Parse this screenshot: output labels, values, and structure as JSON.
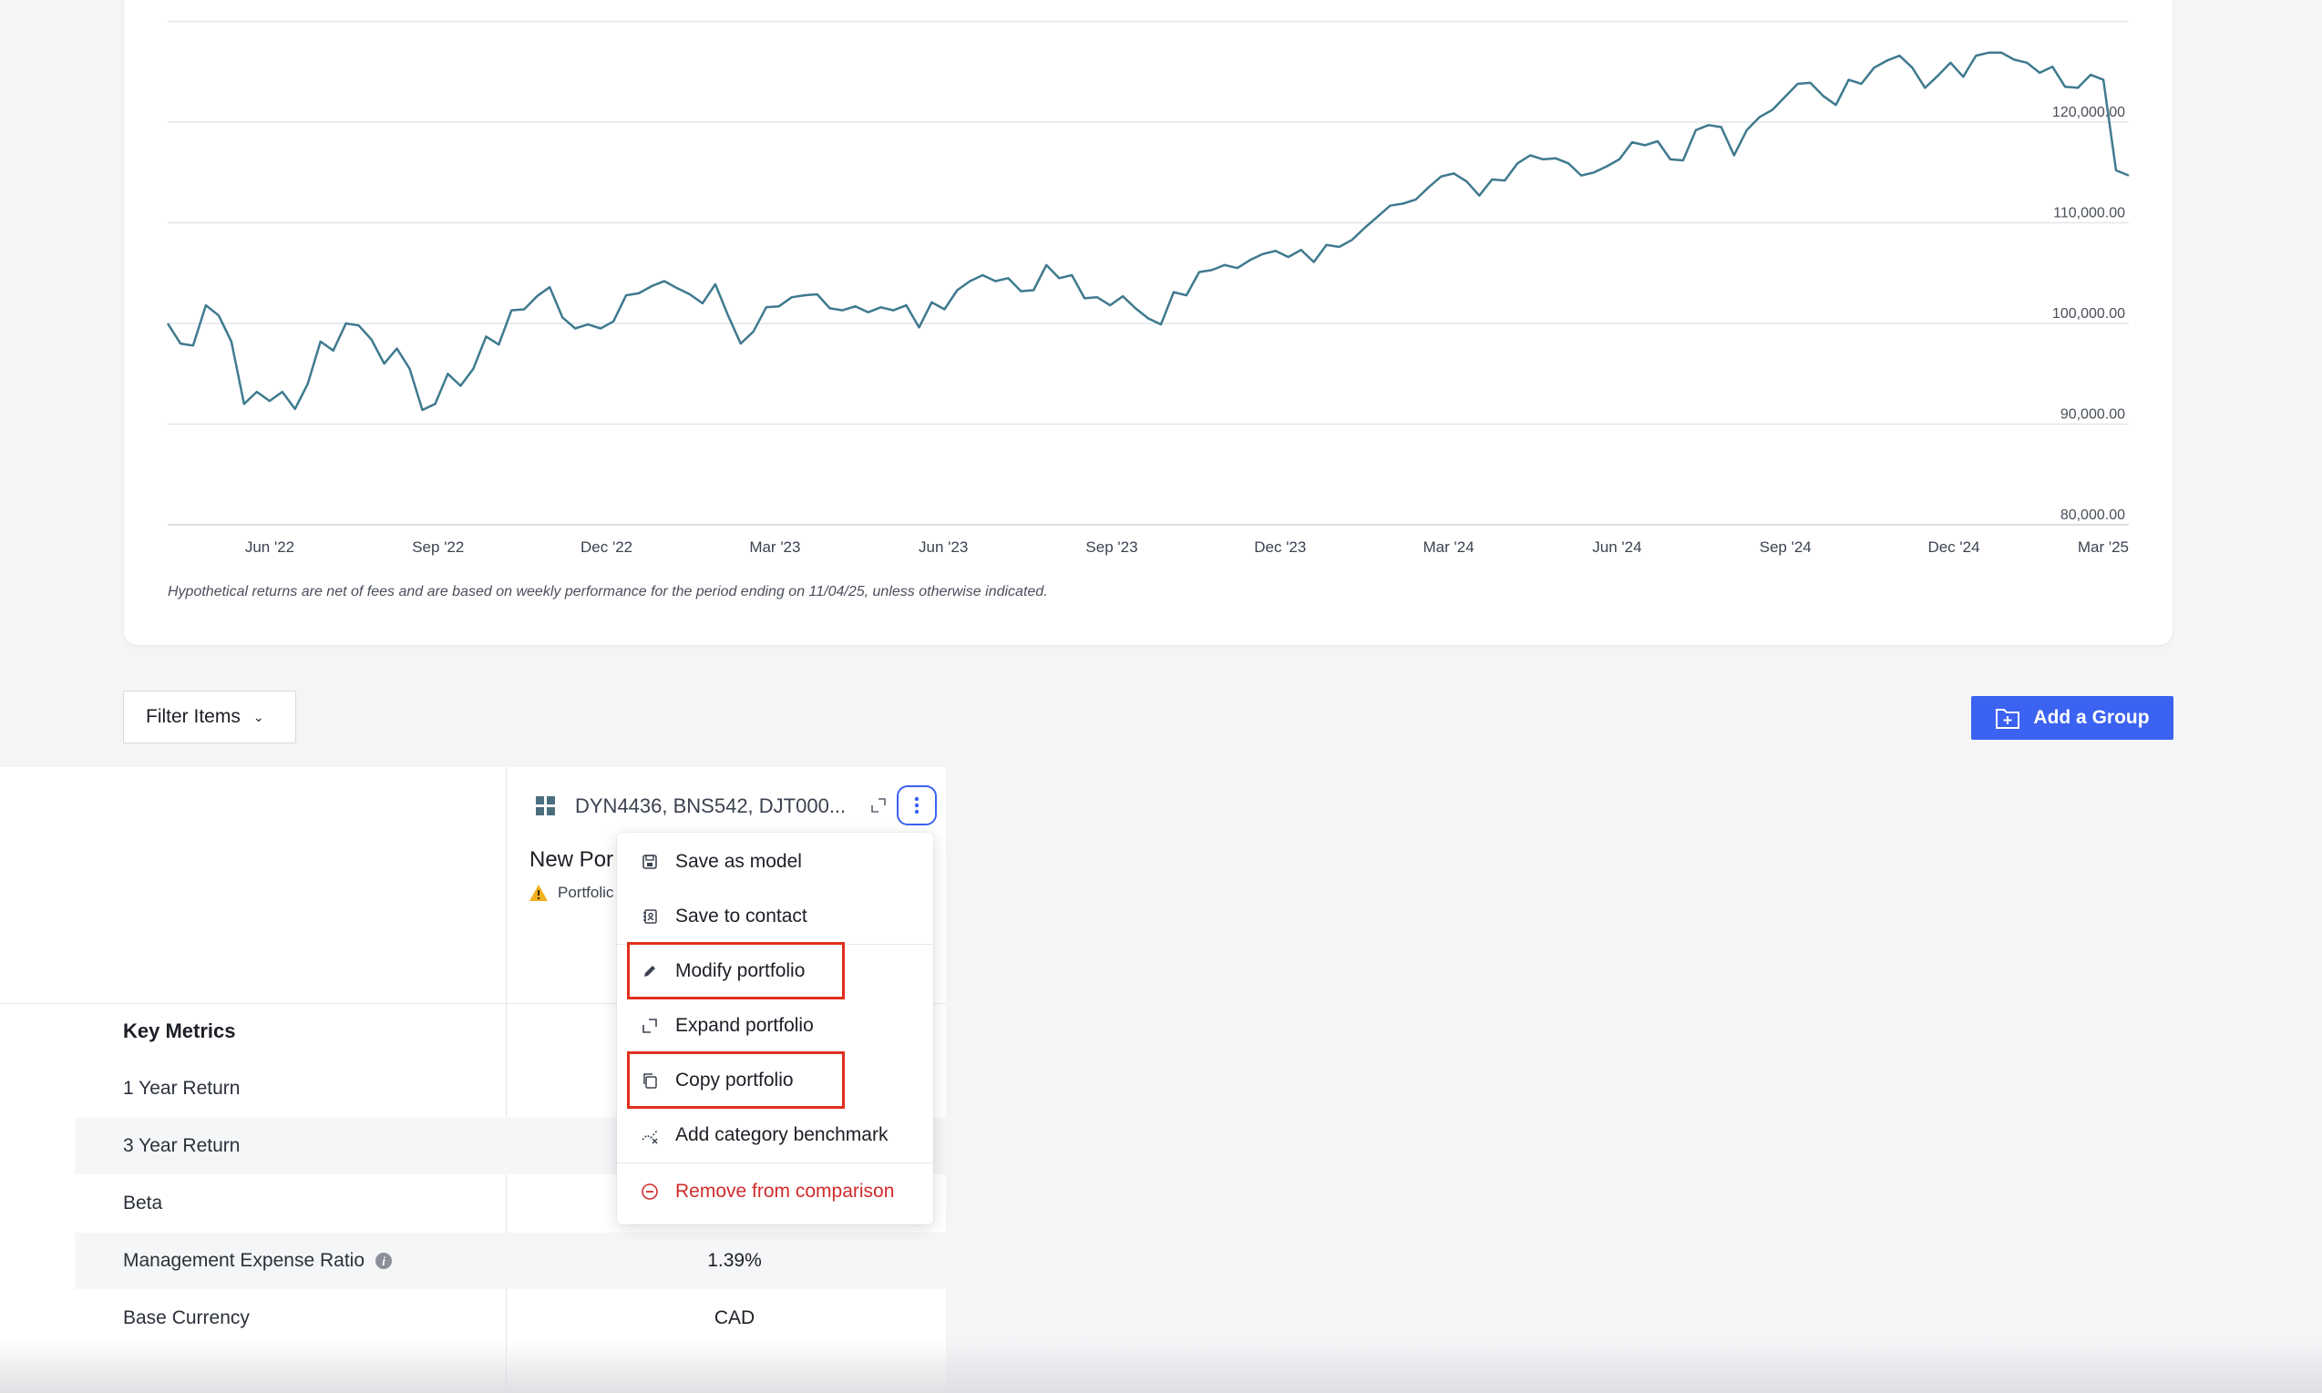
{
  "chart_data": {
    "type": "line",
    "x_ticks": [
      "Jun '22",
      "Sep '22",
      "Dec '22",
      "Mar '23",
      "Jun '23",
      "Sep '23",
      "Dec '23",
      "Mar '24",
      "Jun '24",
      "Sep '24",
      "Dec '24",
      "Mar '25"
    ],
    "y_ticks": [
      "80,000.00",
      "90,000.00",
      "100,000.00",
      "110,000.00",
      "120,000.00"
    ],
    "ylim": [
      80000,
      130000
    ],
    "grid": true,
    "color": "#3f7a8f",
    "series": [
      {
        "values": [
          100000,
          98000,
          97800,
          101800,
          100800,
          98200,
          92000,
          93200,
          92300,
          93200,
          91500,
          94000,
          98200,
          97300,
          100000,
          99800,
          98400,
          96000,
          97500,
          95500,
          91400,
          92000,
          95000,
          93800,
          95500,
          98700,
          97900,
          101300,
          101400,
          102700,
          103600,
          100600,
          99500,
          99900,
          99500,
          100200,
          102800,
          103000,
          103700,
          104200,
          103500,
          102900,
          102000,
          103900,
          100800,
          98000,
          99200,
          101600,
          101700,
          102600,
          102800,
          102900,
          101500,
          101300,
          101700,
          101100,
          101600,
          101300,
          101800,
          99600,
          102100,
          101400,
          103300,
          104200,
          104800,
          104200,
          104500,
          103200,
          103300,
          105800,
          104500,
          104800,
          102500,
          102600,
          101800,
          102700,
          101500,
          100500,
          99900,
          103100,
          102800,
          105100,
          105300,
          105800,
          105500,
          106300,
          106900,
          107200,
          106600,
          107300,
          106100,
          107800,
          107600,
          108300,
          109500,
          110600,
          111700,
          111900,
          112300,
          113500,
          114600,
          114900,
          114100,
          112700,
          114300,
          114200,
          115900,
          116700,
          116300,
          116400,
          115900,
          114700,
          115000,
          115600,
          116300,
          118000,
          117700,
          118100,
          116300,
          116200,
          119200,
          119700,
          119500,
          116700,
          119200,
          120500,
          121200,
          122500,
          123800,
          123900,
          122600,
          121700,
          124200,
          123800,
          125400,
          126100,
          126600,
          125400,
          123400,
          124600,
          125900,
          124500,
          126600,
          126900,
          126900,
          126200,
          125900,
          124900,
          125500,
          123500,
          123400,
          124700,
          124200,
          115200,
          114700
        ]
      }
    ]
  },
  "disclaimer": "Hypothetical returns are net of fees and are based on weekly performance for the period ending on 11/04/25, unless otherwise indicated.",
  "toolbar": {
    "filter_label": "Filter Items",
    "add_group_label": "Add a Group"
  },
  "portfolio": {
    "holdings": "DYN4436, BNS542, DJT000...",
    "name_partial": "New Por",
    "status_partial": "Portfolic"
  },
  "menu": {
    "items": [
      {
        "label": "Save as model",
        "icon": "save-icon"
      },
      {
        "label": "Save to contact",
        "icon": "contact-save-icon"
      },
      {
        "label": "Modify portfolio",
        "icon": "pencil-icon"
      },
      {
        "label": "Expand portfolio",
        "icon": "expand-icon"
      },
      {
        "label": "Copy portfolio",
        "icon": "copy-icon"
      },
      {
        "label": "Add category benchmark",
        "icon": "benchmark-icon"
      },
      {
        "label": "Remove from comparison",
        "icon": "remove-icon"
      }
    ],
    "danger_color": "#d12b2b",
    "highlight_color": "#e0301e"
  },
  "metrics": {
    "heading": "Key Metrics",
    "rows": [
      {
        "label": "1 Year Return",
        "value": ""
      },
      {
        "label": "3 Year Return",
        "value": ""
      },
      {
        "label": "Beta",
        "value": ""
      },
      {
        "label": "Management Expense Ratio",
        "value": "1.39%"
      },
      {
        "label": "Base Currency",
        "value": "CAD"
      }
    ]
  },
  "colors": {
    "accent": "#3b62f0",
    "line": "#3f7a8f"
  }
}
